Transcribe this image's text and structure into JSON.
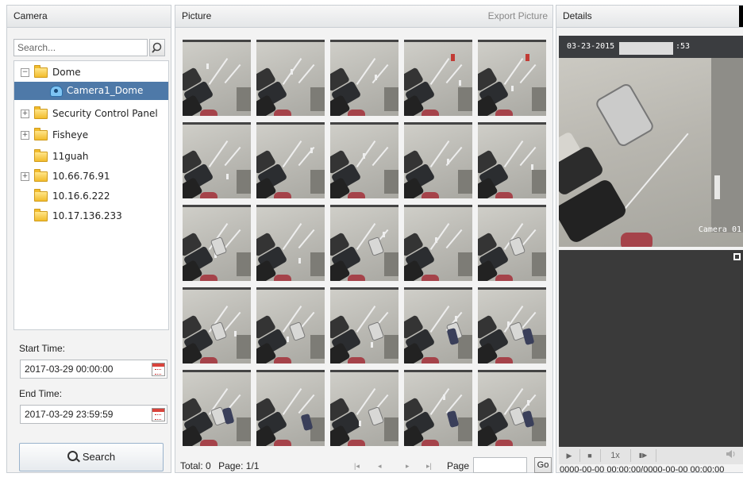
{
  "camera_panel": {
    "title": "Camera",
    "search_placeholder": "Search...",
    "tree": [
      {
        "label": "Dome",
        "expander": "−",
        "type": "folder"
      },
      {
        "label": "Camera1_Dome",
        "type": "camera",
        "selected": true
      },
      {
        "label": "Security Control Panel",
        "expander": "+",
        "type": "folder"
      },
      {
        "label": "Fisheye",
        "expander": "+",
        "type": "folder"
      },
      {
        "label": "11guah",
        "type": "folder"
      },
      {
        "label": "10.66.76.91",
        "expander": "+",
        "type": "folder"
      },
      {
        "label": "10.16.6.222",
        "type": "folder"
      },
      {
        "label": "10.17.136.233",
        "type": "folder"
      }
    ],
    "start_time_label": "Start Time:",
    "start_time": "2017-03-29 00:00:00",
    "end_time_label": "End Time:",
    "end_time": "2017-03-29 23:59:59",
    "search_button": "Search"
  },
  "picture_panel": {
    "title": "Picture",
    "export_button": "Export Picture",
    "selected_thumbnail": 16,
    "thumbnail_count": 25,
    "footer": {
      "total_label": "Total:",
      "total": "0",
      "page_label": "Page:",
      "page": "1/1",
      "first": "|◂",
      "prev": "◂",
      "next": "▸",
      "last": "▸|",
      "goto_label": "Page",
      "go_button": "Go"
    }
  },
  "details_panel": {
    "title": "Details",
    "snapshot_date": "03-23-2015",
    "snapshot_seconds": ":53",
    "snapshot_camera_label": "Camera 01",
    "controls": {
      "play": "▶",
      "stop": "■",
      "speed": "1x",
      "step": "▮▶"
    },
    "time_range": "0000-00-00 00:00:00/0000-00-00 00:00:00"
  },
  "colors": {
    "selection": "#4e79a8",
    "thumb_highlight": "#f4e622",
    "panel_header": "#e4e6e8",
    "video_bg": "#3a3a3a"
  }
}
